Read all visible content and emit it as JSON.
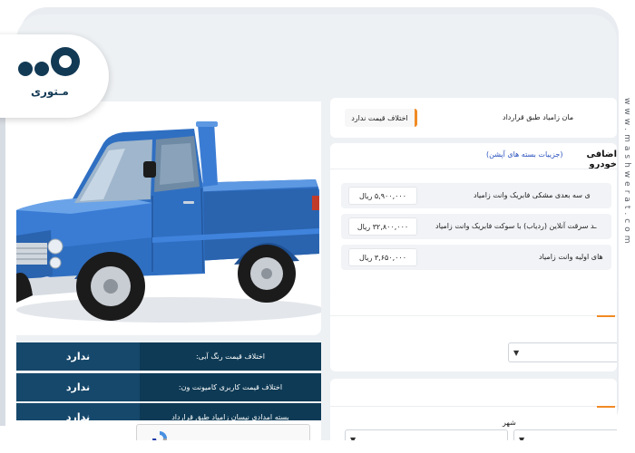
{
  "brand": {
    "logo_text": "مـتوری",
    "watermark": "www.mashwerat.com"
  },
  "left": {
    "spec_rows": [
      {
        "label": "اختلاف قیمت رنگ آبی:",
        "value": "ندارد"
      },
      {
        "label": "اختلاف قیمت کاربری کامیونت ون:",
        "value": "ندارد"
      },
      {
        "label": "بسته امدادی نیسان زامیاد طبق قرارداد",
        "value": "ندارد"
      }
    ]
  },
  "right": {
    "top_card": {
      "row_label": "مان زامیاد طبق قرارداد",
      "row_value": "اختلاف قیمت ندارد"
    },
    "options_card": {
      "title": "اضافی خودرو",
      "details_link": "(جزییات بسته های آپشن)",
      "options": [
        {
          "name": "ی سه بعدی مشکی فابریک وانت زامیاد",
          "price": "۵,۹۰۰,۰۰۰ ریال"
        },
        {
          "name": "ـد سرقت آنلاین (ردیاب) با سوکت فابریک وانت زامیاد",
          "price": "۳۲,۸۰۰,۰۰۰ ریال"
        },
        {
          "name": "های اولیه وانت زامیاد",
          "price": "۳,۶۵۰,۰۰۰ ریال"
        }
      ]
    },
    "city_label": "شهر"
  },
  "colors": {
    "navy": "#0e3a55",
    "accent_orange": "#f08a24",
    "link_blue": "#2a52be",
    "car_blue": "#2f6fc2"
  }
}
